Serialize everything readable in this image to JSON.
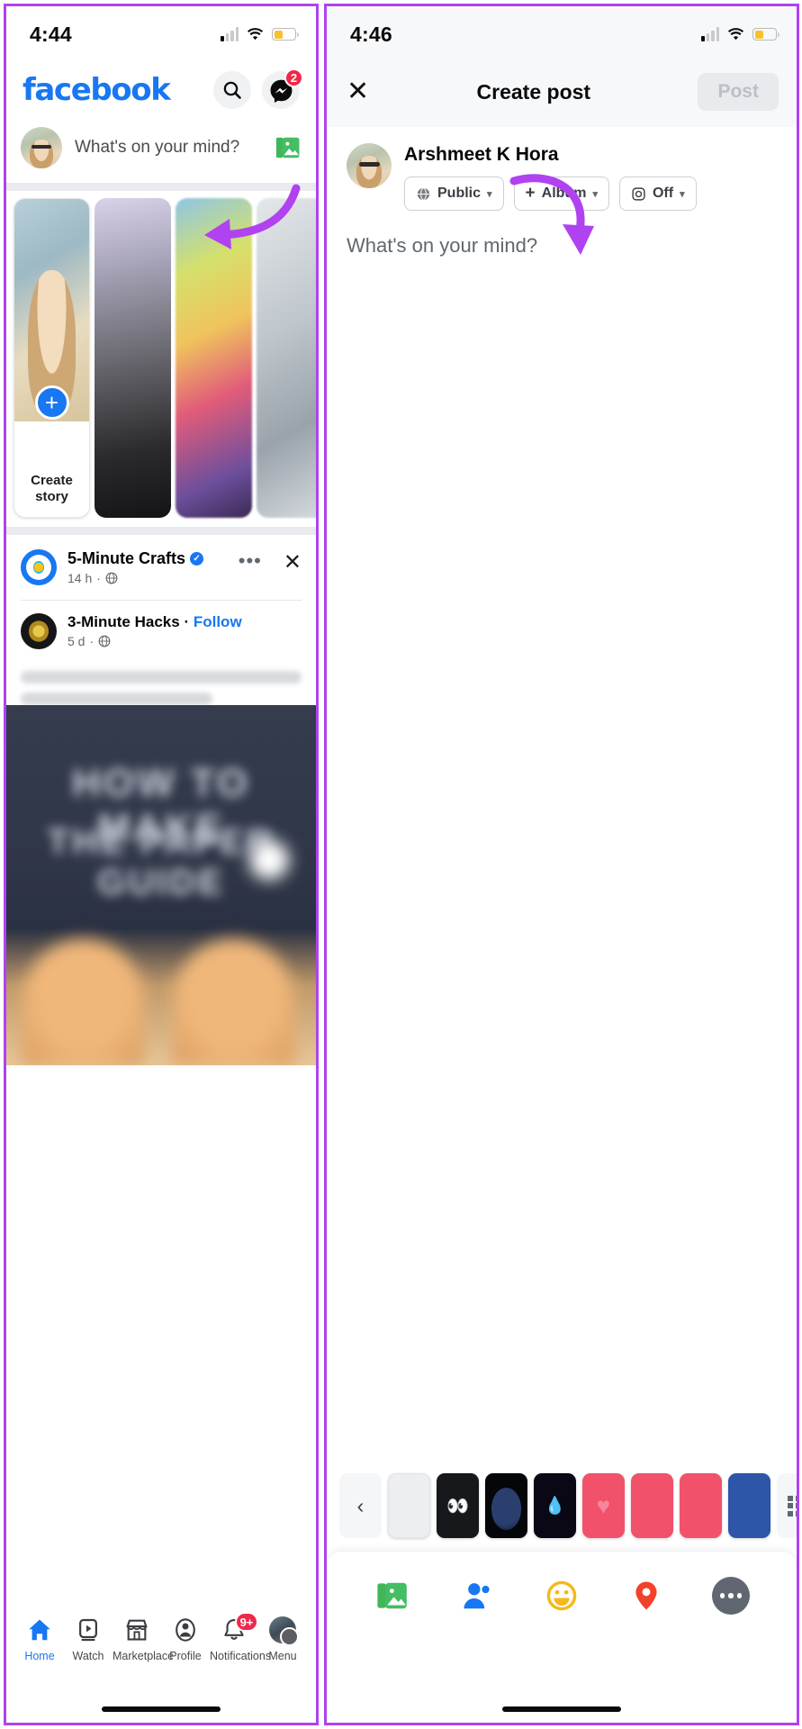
{
  "left_phone": {
    "status_bar": {
      "time": "4:44",
      "signal_icon": "signal-bars-icon",
      "wifi_icon": "wifi-icon",
      "battery_icon": "battery-icon"
    },
    "header": {
      "logo_text": "facebook",
      "search_icon": "search-icon",
      "messenger_icon": "messenger-icon",
      "messenger_badge": "2"
    },
    "composer": {
      "placeholder": "What's on your mind?",
      "photo_icon": "photo-library-icon"
    },
    "stories": [
      {
        "label_line1": "Create",
        "label_line2": "story",
        "type": "create-story"
      },
      {
        "label_line1": "",
        "label_line2": "",
        "type": "story-thumb"
      },
      {
        "label_line1": "",
        "label_line2": "",
        "type": "story-thumb"
      },
      {
        "label_line1": "",
        "label_line2": "",
        "type": "story-thumb"
      }
    ],
    "post": {
      "page_name": "5-Minute Crafts",
      "verified_glyph": "✓",
      "timestamp": "14 h",
      "dot": "·",
      "globe_icon": "globe-icon",
      "more_icon": "more-options-icon",
      "close_icon": "close-icon",
      "shared_name": "3-Minute Hacks",
      "shared_separator": "·",
      "shared_follow": "Follow",
      "shared_timestamp": "5 d",
      "image_text_line1": "HOW TO MAKE",
      "image_text_line2": "THE PAPER GUIDE"
    },
    "bottom_nav": [
      {
        "label": "Home",
        "icon": "home-icon",
        "active": true,
        "badge": ""
      },
      {
        "label": "Watch",
        "icon": "watch-icon",
        "active": false,
        "badge": ""
      },
      {
        "label": "Marketplace",
        "icon": "marketplace-icon",
        "active": false,
        "badge": ""
      },
      {
        "label": "Profile",
        "icon": "profile-icon",
        "active": false,
        "badge": ""
      },
      {
        "label": "Notifications",
        "icon": "bell-icon",
        "active": false,
        "badge": "9+"
      },
      {
        "label": "Menu",
        "icon": "menu-avatar-icon",
        "active": false,
        "badge": ""
      }
    ]
  },
  "right_phone": {
    "status_bar": {
      "time": "4:46",
      "signal_icon": "signal-bars-icon",
      "wifi_icon": "wifi-icon",
      "battery_icon": "battery-icon"
    },
    "header": {
      "close_label": "✕",
      "title": "Create post",
      "post_label": "Post"
    },
    "author": {
      "name": "Arshmeet K Hora"
    },
    "chips": [
      {
        "label": "Public",
        "icon": "globe-icon",
        "caret": "▾"
      },
      {
        "label": "Album",
        "icon": "plus-icon",
        "caret": "▾"
      },
      {
        "label": "Off",
        "icon": "instagram-icon",
        "caret": "▾"
      }
    ],
    "composer_placeholder": "What's on your mind?",
    "thumb_strip": {
      "back_chevron": "‹",
      "grid_icon": "grid-icon",
      "thumbs": [
        {
          "kind": "blank",
          "glyph": ""
        },
        {
          "kind": "dark-eyes",
          "glyph": "👀"
        },
        {
          "kind": "dark-disc",
          "glyph": ""
        },
        {
          "kind": "dark-drops",
          "glyph": "💧"
        },
        {
          "kind": "pink-heart",
          "glyph": "♥"
        },
        {
          "kind": "pink",
          "glyph": ""
        },
        {
          "kind": "pink",
          "glyph": ""
        },
        {
          "kind": "blue",
          "glyph": ""
        }
      ]
    },
    "action_bar": [
      {
        "icon": "photo-library-icon",
        "label": "Photo/video"
      },
      {
        "icon": "tag-people-icon",
        "label": "Tag people"
      },
      {
        "icon": "feeling-icon",
        "label": "Feeling/activity"
      },
      {
        "icon": "location-pin-icon",
        "label": "Check in"
      },
      {
        "icon": "more-options-icon",
        "label": "More"
      }
    ]
  },
  "annotations": {
    "arrow_left": "purple-arrow-pointing-to-composer",
    "arrow_right": "purple-arrow-pointing-to-off-chip",
    "frame_color": "#b042f0"
  }
}
